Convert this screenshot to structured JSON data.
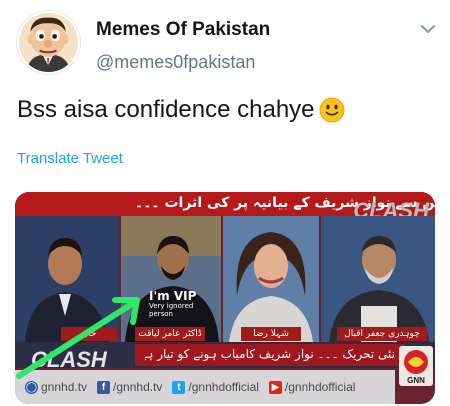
{
  "tweet": {
    "display_name": "Memes Of Pakistan",
    "handle": "@memes0fpakistan",
    "text": "Bss aisa confidence chahye",
    "translate_label": "Translate Tweet"
  },
  "media": {
    "top_banner_text": "ن لیگ میں سے نواز شریف کے بیانیہ پر کی اثرات ۔۔۔",
    "channel_logo": "CLASH",
    "shirt_line1": "I'm VIP",
    "shirt_line2": "Very ignored",
    "shirt_line3": "person",
    "nameplates": [
      "خان",
      "ڈاکٹر عامر لیاقت",
      "شہلا رضا",
      "چوہدری جعفر اقبال"
    ],
    "ticker_logo": "CLASH",
    "ticker_text": "نئی تحریک ۔۔۔ نواز شریف کامیاب ہونے کو تیار ہے ؟ حاصل",
    "social": [
      {
        "icon": "globe-icon",
        "label": "gnnhd.tv"
      },
      {
        "icon": "facebook-icon",
        "label": "/gnnhd.tv"
      },
      {
        "icon": "twitter-icon",
        "label": "/gnnhdofficial"
      },
      {
        "icon": "youtube-icon",
        "label": "/gnnhdofficial"
      }
    ],
    "gnn_logo_text": "GNN"
  },
  "colors": {
    "link": "#1da1f2",
    "arrow": "#2ee86a",
    "banner_red": "#b51a1a"
  }
}
